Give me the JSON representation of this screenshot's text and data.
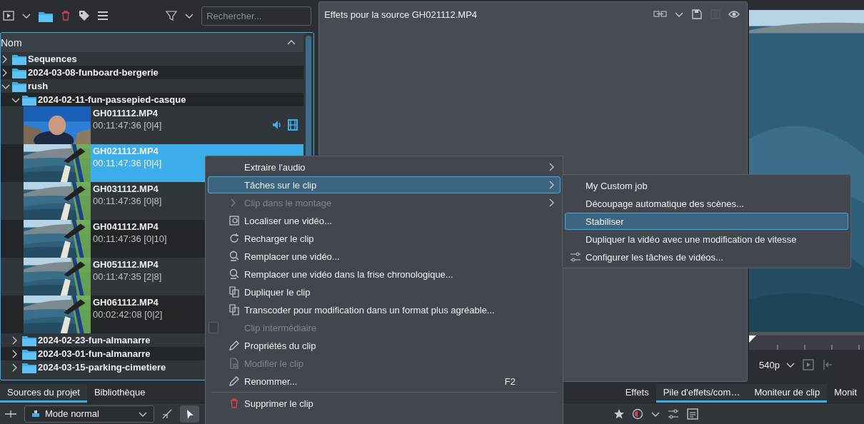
{
  "project_bin": {
    "search": {
      "placeholder": "Rechercher..."
    },
    "column_header": "Nom",
    "tree": [
      {
        "kind": "folder",
        "label": "Sequences",
        "expanded": false
      },
      {
        "kind": "folder",
        "label": "2024-03-08-funboard-bergerie",
        "expanded": false
      },
      {
        "kind": "folder",
        "label": "rush",
        "expanded": true,
        "children": [
          {
            "kind": "folder",
            "label": "2024-02-11-fun-passepied-casque",
            "expanded": true,
            "children": [
              {
                "kind": "clip",
                "name": "GH011112.MP4",
                "info": "00:11:47:36 [0|4]",
                "selected": false,
                "type_icons": true
              },
              {
                "kind": "clip",
                "name": "GH021112.MP4",
                "info": "00:11:47:36 [0|4]",
                "selected": true
              },
              {
                "kind": "clip",
                "name": "GH031112.MP4",
                "info": "00:11:47:36 [0|8]",
                "selected": false
              },
              {
                "kind": "clip",
                "name": "GH041112.MP4",
                "info": "00:11:47:36 [0|10]",
                "selected": false
              },
              {
                "kind": "clip",
                "name": "GH051112.MP4",
                "info": "00:11:47:35 [2|8]",
                "selected": false
              },
              {
                "kind": "clip",
                "name": "GH061112.MP4",
                "info": "00:02:42:08 [0|2]",
                "selected": false
              }
            ]
          },
          {
            "kind": "folder",
            "label": "2024-02-23-fun-almanarre",
            "expanded": false
          },
          {
            "kind": "folder",
            "label": "2024-03-01-fun-almanarre",
            "expanded": false
          },
          {
            "kind": "folder",
            "label": "2024-03-15-parking-cimetiere",
            "expanded": false
          }
        ]
      }
    ]
  },
  "effects_panel": {
    "title": "Effets pour la source GH021112.MP4"
  },
  "monitor": {
    "resolution": "540p"
  },
  "tab_bars": [
    {
      "tabs": [
        {
          "label": "Sources du projet",
          "selected": true
        },
        {
          "label": "Bibliothèque",
          "selected": false
        }
      ]
    },
    {
      "tabs": [
        {
          "label": "Effets",
          "selected": false
        },
        {
          "label": "Pile d'effets/com…",
          "selected": true
        }
      ]
    },
    {
      "tabs": [
        {
          "label": "Moniteur de clip",
          "selected": true
        },
        {
          "label": "Monit",
          "selected": false
        }
      ]
    }
  ],
  "timeline_toolbar": {
    "mode": "Mode normal"
  },
  "context_menu": {
    "items": [
      {
        "kind": "submenu",
        "label": "Extraire l'audio",
        "disabled": false,
        "selected": false
      },
      {
        "kind": "submenu",
        "label": "Tâches sur le clip",
        "disabled": false,
        "selected": true
      },
      {
        "kind": "submenu",
        "label": "Clip dans le montage",
        "disabled": true,
        "selected": false
      },
      {
        "kind": "action",
        "label": "Localiser une vidéo...",
        "disabled": false,
        "selected": false
      },
      {
        "kind": "action",
        "label": "Recharger le clip",
        "disabled": false,
        "selected": false
      },
      {
        "kind": "action",
        "label": "Remplacer une vidéo...",
        "disabled": false,
        "selected": false
      },
      {
        "kind": "action",
        "label": "Remplacer une vidéo dans la frise chronologique...",
        "disabled": false,
        "selected": false
      },
      {
        "kind": "action",
        "label": "Dupliquer le clip",
        "disabled": false,
        "selected": false
      },
      {
        "kind": "action",
        "label": "Transcoder pour modification dans un format plus agréable...",
        "disabled": false,
        "selected": false
      },
      {
        "kind": "checkbox",
        "label": "Clip intermédiaire",
        "checked": false,
        "disabled": true,
        "selected": false
      },
      {
        "kind": "action",
        "label": "Propriétés du clip",
        "disabled": false,
        "selected": false
      },
      {
        "kind": "action",
        "label": "Modifier le clip",
        "disabled": true,
        "selected": false
      },
      {
        "kind": "action",
        "label": "Renommer...",
        "shortcut": "F2",
        "disabled": false,
        "selected": false
      },
      {
        "kind": "separator"
      },
      {
        "kind": "action",
        "label": "Supprimer le clip",
        "disabled": false,
        "selected": false
      }
    ]
  },
  "submenu": {
    "items": [
      {
        "label": "My Custom job",
        "selected": false
      },
      {
        "label": "Découpage automatique des scènes...",
        "selected": false
      },
      {
        "label": "Stabiliser",
        "selected": true
      },
      {
        "label": "Dupliquer la vidéo avec une modification de vitesse",
        "selected": false
      },
      {
        "label": "Configurer les tâches de vidéos...",
        "selected": false
      }
    ]
  }
}
